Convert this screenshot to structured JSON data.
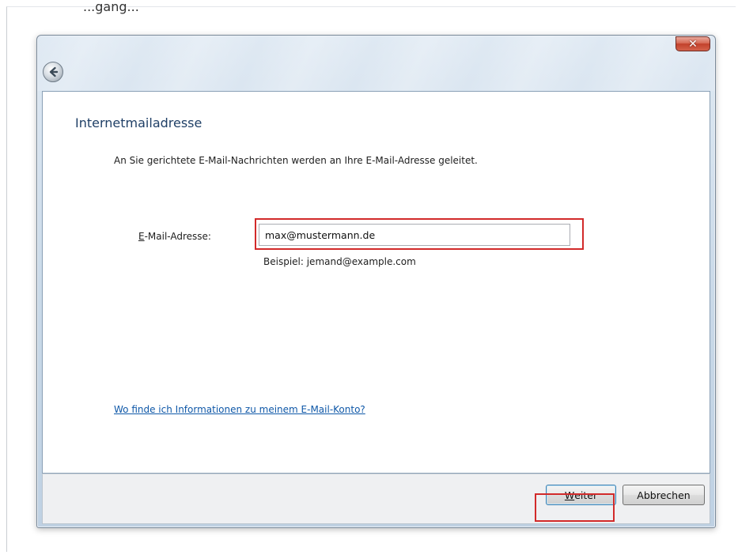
{
  "background_heading_fragment": "...gang...",
  "wizard": {
    "title": "Internetmailadresse",
    "description": "An Sie gerichtete E-Mail-Nachrichten werden an Ihre E-Mail-Adresse geleitet.",
    "email_label_mnemonic": "E",
    "email_label_rest": "-Mail-Adresse:",
    "email_value": "max@mustermann.de",
    "example_hint": "Beispiel: jemand@example.com",
    "help_link": "Wo finde ich Informationen zu meinem E-Mail-Konto?"
  },
  "buttons": {
    "next_mnemonic": "W",
    "next_rest": "eiter",
    "cancel": "Abbrechen"
  },
  "titlebar": {
    "close_icon": "close-icon",
    "back_icon": "back-arrow-icon"
  },
  "colors": {
    "title_text": "#1f3f66",
    "link": "#0f58a8",
    "highlight": "#d22a2a",
    "close_button": "#c2412b"
  }
}
